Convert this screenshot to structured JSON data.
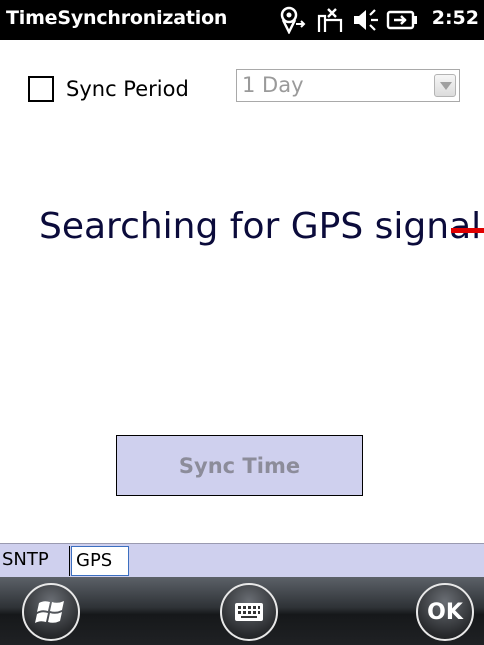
{
  "titlebar": {
    "title": "TimeSynchronization",
    "clock": "2:52",
    "icons": [
      "gps-connect-icon",
      "no-signal-icon",
      "speaker-icon",
      "battery-icon"
    ]
  },
  "sync_period": {
    "checkbox_label": "Sync Period",
    "checked": false,
    "selected_value": "1 Day"
  },
  "status": {
    "message": "Searching for GPS signal"
  },
  "sync_button": {
    "label": "Sync Time",
    "enabled": false
  },
  "tabs": [
    {
      "label": "SNTP",
      "active": false
    },
    {
      "label": "GPS",
      "active": true
    }
  ],
  "softkeys": {
    "start_icon": "windows-start-icon",
    "keyboard_icon": "keyboard-icon",
    "ok_label": "OK"
  },
  "colors": {
    "accent_panel": "#cfd0ee",
    "status_text": "#0b0b3b",
    "indicator": "#e00000"
  }
}
